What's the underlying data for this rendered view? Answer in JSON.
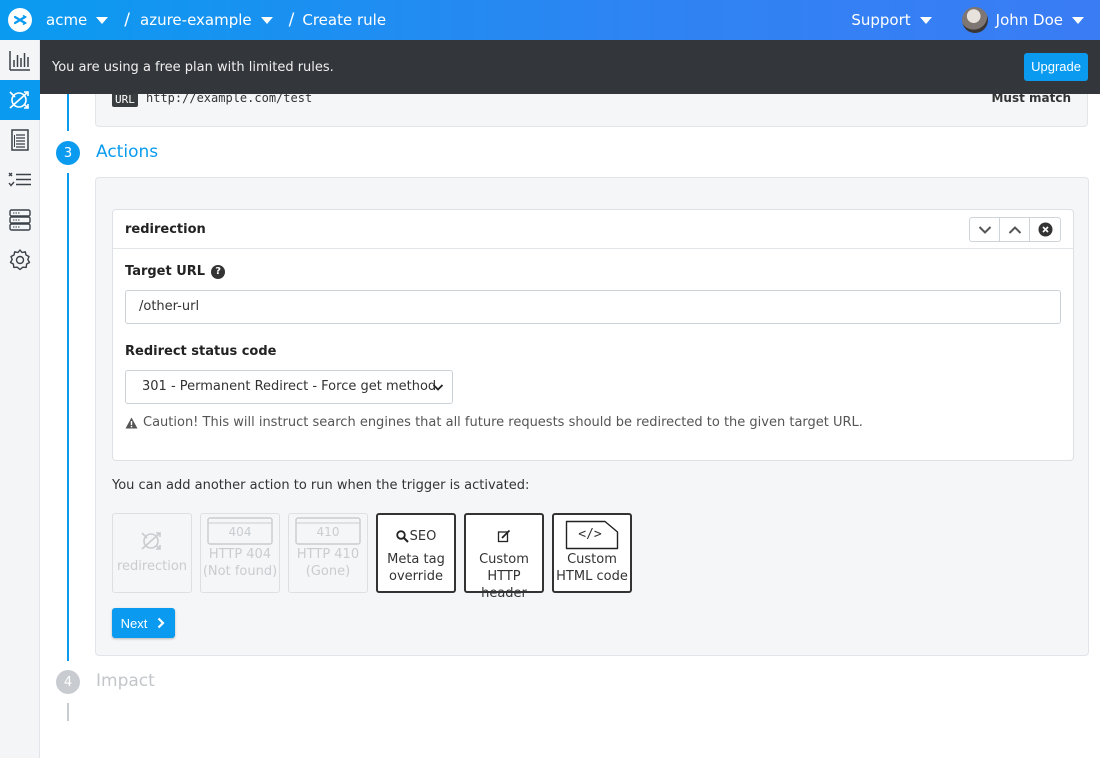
{
  "topbar": {
    "org": "acme",
    "project": "azure-example",
    "page": "Create rule",
    "support_label": "Support",
    "user_name": "John Doe"
  },
  "sidebar": {
    "items": [
      {
        "icon": "analytics-icon"
      },
      {
        "icon": "rules-icon",
        "active": true
      },
      {
        "icon": "logs-icon"
      },
      {
        "icon": "checklist-icon"
      },
      {
        "icon": "servers-icon"
      },
      {
        "icon": "settings-icon"
      }
    ]
  },
  "banner": {
    "message": "You are using a free plan with limited rules.",
    "upgrade_label": "Upgrade"
  },
  "trigger_summary": {
    "tag": "URL",
    "value": "http://example.com/test",
    "match": "Must match"
  },
  "steps": {
    "actions": {
      "number": "3",
      "title": "Actions"
    },
    "impact": {
      "number": "4",
      "title": "Impact"
    }
  },
  "action_card": {
    "title": "redirection",
    "target_url_label": "Target URL",
    "target_url_value": "/other-url",
    "status_label": "Redirect status code",
    "status_value": "301 - Permanent Redirect - Force get method",
    "caution": "Caution! This will instruct search engines that all future requests should be redirected to the given target URL."
  },
  "add_action": {
    "prompt": "You can add another action to run when the trigger is activated:",
    "tiles": [
      {
        "line1": "redirection",
        "line2": "",
        "disabled": true,
        "icon": "redirection-icon"
      },
      {
        "line1": "HTTP 404",
        "line2": "(Not found)",
        "disabled": true,
        "icon": "http-404-icon",
        "badge": "404"
      },
      {
        "line1": "HTTP 410",
        "line2": "(Gone)",
        "disabled": true,
        "icon": "http-410-icon",
        "badge": "410"
      },
      {
        "line1": "Meta tag",
        "line2": "override",
        "disabled": false,
        "icon": "seo-icon",
        "badge": "SEO"
      },
      {
        "line1": "Custom",
        "line2": "HTTP header",
        "disabled": false,
        "icon": "edit-icon"
      },
      {
        "line1": "Custom",
        "line2": "HTML code",
        "disabled": false,
        "icon": "code-icon",
        "badge": "</>"
      }
    ],
    "next_label": "Next"
  },
  "colors": {
    "accent": "#0a9bf0",
    "banner_bg": "#33363a",
    "step_inactive": "#c8ccd0"
  }
}
